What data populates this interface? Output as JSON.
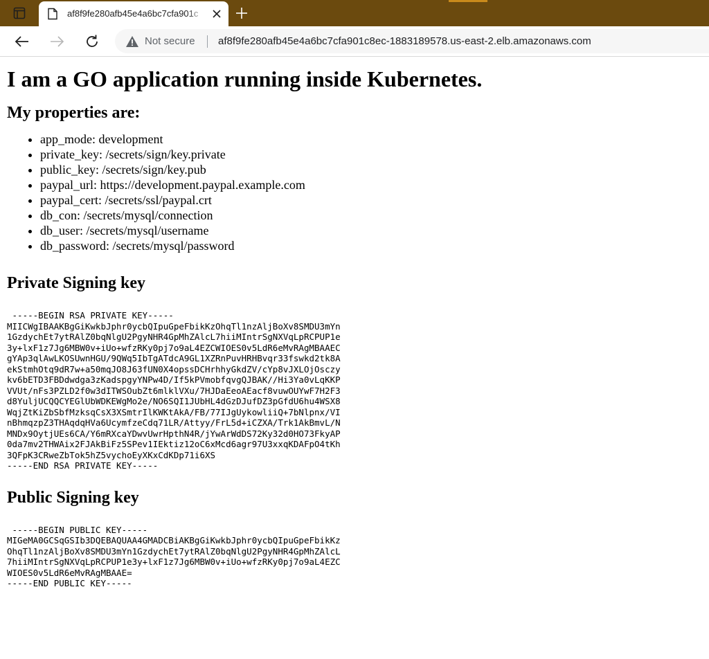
{
  "browser": {
    "tab_title": "af8f9fe280afb45e4a6bc7cfa901c",
    "security_label": "Not secure",
    "url": "af8f9fe280afb45e4a6bc7cfa901c8ec-1883189578.us-east-2.elb.amazonaws.com",
    "icons": {
      "tab_actions": "tab-actions-icon",
      "page": "page-icon",
      "close": "close-icon",
      "new_tab": "plus-icon",
      "back": "back-arrow-icon",
      "forward": "forward-arrow-icon",
      "reload": "reload-icon",
      "warning": "warning-icon"
    }
  },
  "page": {
    "heading": "I am a GO application running inside Kubernetes.",
    "properties_heading": "My properties are:",
    "properties": [
      "app_mode: development",
      "private_key: /secrets/sign/key.private",
      "public_key: /secrets/sign/key.pub",
      "paypal_url: https://development.paypal.example.com",
      "paypal_cert: /secrets/ssl/paypal.crt",
      "db_con: /secrets/mysql/connection",
      "db_user: /secrets/mysql/username",
      "db_password: /secrets/mysql/password"
    ],
    "private_key_heading": "Private Signing key",
    "private_key_lines": [
      " -----BEGIN RSA PRIVATE KEY-----",
      "MIICWgIBAAKBgGiKwkbJphr0ycbQIpuGpeFbikKzOhqTl1nzAljBoXv8SMDU3mYn",
      "1GzdychEt7ytRAlZ0bqNlgU2PgyNHR4GpMhZAlcL7hiiMIntrSgNXVqLpRCPUP1e",
      "3y+lxF1z7Jg6MBW0v+iUo+wfzRKy0pj7o9aL4EZCWIOES0v5LdR6eMvRAgMBAAEC",
      "gYAp3qlAwLKOSUwnHGU/9QWq5IbTgATdcA9GL1XZRnPuvHRHBvqr33fswkd2tk8A",
      "ekStmhOtq9dR7w+a50mqJO8J63fUN0X4opssDCHrhhyGkdZV/cYp8vJXLOjOsczy",
      "kv6bETD3FBDdwdga3zKadspgyYNPw4D/If5kPVmobfqvgQJBAK//Hi3Ya0vLqKKP",
      "VVUt/nFs3PZLD2f0w3dITWSOubZt6mlklVXu/7HJDaEeoAEacf8vuwOUYwF7H2F3",
      "d8YuljUCQQCYEGlUbWDKEWgMo2e/NO6SQI1JUbHL4dGzDJufDZ3pGfdU6hu4WSX8",
      "WqjZtKiZbSbfMzksqCsX3XSmtrIlKWKtAkA/FB/77IJgUykowliiQ+7bNlpnx/VI",
      "nBhmqzpZ3THAqdqHVa6UcymfzeCdq71LR/Attyy/FrL5d+iCZXA/Trk1AkBmvL/N",
      "MNDx9OytjUEs6CA/Y6mRXcaYDwvUwrHpthN4R/jYwArWdDS72Ky32d0HO73FkyAP",
      "0da7mv2THWAix2FJAkBiFz5SPev1IEktiz12oC6xMcd6agr97U3xxqKDAFpO4tKh",
      "3QFpK3CRweZbTok5hZ5vychoEyXKxCdKDp71i6XS",
      "-----END RSA PRIVATE KEY-----"
    ],
    "public_key_heading": "Public Signing key",
    "public_key_lines": [
      " -----BEGIN PUBLIC KEY-----",
      "MIGeMA0GCSqGSIb3DQEBAQUAA4GMADCBiAKBgGiKwkbJphr0ycbQIpuGpeFbikKz",
      "OhqTl1nzAljBoXv8SMDU3mYn1GzdychEt7ytRAlZ0bqNlgU2PgyNHR4GpMhZAlcL",
      "7hiiMIntrSgNXVqLpRCPUP1e3y+lxF1z7Jg6MBW0v+iUo+wfzRKy0pj7o9aL4EZC",
      "WIOES0v5LdR6eMvRAgMBAAE=",
      "-----END PUBLIC KEY-----"
    ]
  },
  "colors": {
    "tabbar": "#6b4a0e",
    "accent": "#c98a1b",
    "address_bg": "#f6f6f6"
  }
}
